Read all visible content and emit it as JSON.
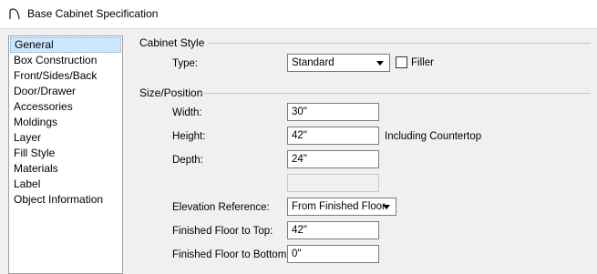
{
  "window": {
    "title": "Base Cabinet Specification",
    "icon": "cabinet-arc-icon"
  },
  "nav": {
    "items": [
      "General",
      "Box Construction",
      "Front/Sides/Back",
      "Door/Drawer",
      "Accessories",
      "Moldings",
      "Layer",
      "Fill Style",
      "Materials",
      "Label",
      "Object Information"
    ],
    "selected": "General"
  },
  "cabinet_style": {
    "group_label": "Cabinet Style",
    "type_label": "Type:",
    "type_value": "Standard",
    "filler_label": "Filler",
    "filler_checked": false
  },
  "size_position": {
    "group_label": "Size/Position",
    "width_label": "Width:",
    "width_value": "30\"",
    "height_label": "Height:",
    "height_value": "42\"",
    "height_note": "Including Countertop",
    "depth_label": "Depth:",
    "depth_value": "24\"",
    "blank_value": "",
    "elevation_label": "Elevation Reference:",
    "elevation_value": "From Finished Floor",
    "floor_top_label": "Finished Floor to Top:",
    "floor_top_value": "42\"",
    "floor_bottom_label": "Finished Floor to Bottom:",
    "floor_bottom_value": "0\""
  },
  "colors": {
    "selection": "#cce8ff",
    "background": "#f0f0f0"
  }
}
